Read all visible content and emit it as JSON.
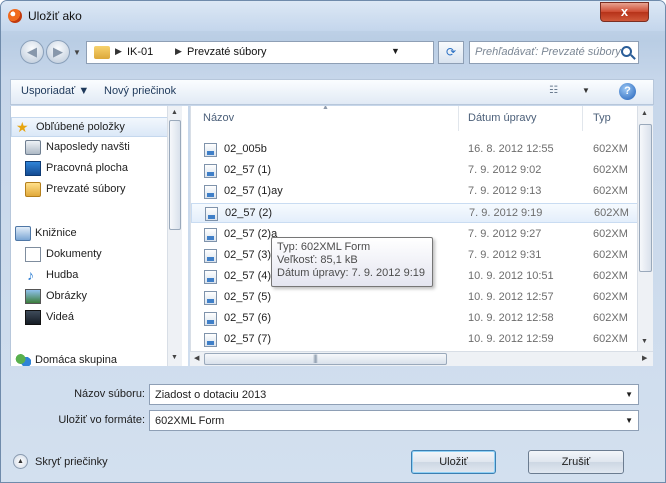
{
  "window": {
    "title": "Uložiť ako",
    "close_label": "x"
  },
  "nav": {
    "back": "◀",
    "forward": "▶"
  },
  "address": {
    "crumbs": [
      "IK-01",
      "Prevzaté súbory"
    ]
  },
  "search": {
    "placeholder": "Prehľadávať: Prevzaté súbory"
  },
  "toolbar": {
    "organize": "Usporiadať ▼",
    "new_folder": "Nový priečinok"
  },
  "sidebar": {
    "favorites_label": "Obľúbené položky",
    "favorites": [
      "Naposledy navšti",
      "Pracovná plocha",
      "Prevzaté súbory"
    ],
    "libraries_label": "Knižnice",
    "libraries": [
      "Dokumenty",
      "Hudba",
      "Obrázky",
      "Videá"
    ],
    "homegroup_label": "Domáca skupina"
  },
  "columns": {
    "name": "Názov",
    "date": "Dátum úpravy",
    "type": "Typ"
  },
  "files": [
    {
      "name": "02_005b",
      "date": "16. 8. 2012 12:55",
      "type": "602XM"
    },
    {
      "name": "02_57 (1)",
      "date": "7. 9. 2012 9:02",
      "type": "602XM"
    },
    {
      "name": "02_57 (1)ay",
      "date": "7. 9. 2012 9:13",
      "type": "602XM"
    },
    {
      "name": "02_57 (2)",
      "date": "7. 9. 2012 9:19",
      "type": "602XM"
    },
    {
      "name": "02_57 (2)a",
      "date": "7. 9. 2012 9:27",
      "type": "602XM"
    },
    {
      "name": "02_57 (3)",
      "date": "7. 9. 2012 9:31",
      "type": "602XM"
    },
    {
      "name": "02_57 (4)",
      "date": "10. 9. 2012 10:51",
      "type": "602XM"
    },
    {
      "name": "02_57 (5)",
      "date": "10. 9. 2012 12:57",
      "type": "602XM"
    },
    {
      "name": "02_57 (6)",
      "date": "10. 9. 2012 12:58",
      "type": "602XM"
    },
    {
      "name": "02_57 (7)",
      "date": "10. 9. 2012 12:59",
      "type": "602XM"
    }
  ],
  "tooltip": {
    "type": "Typ: 602XML Form",
    "size": "Veľkosť: 85,1 kB",
    "modified": "Dátum úpravy: 7. 9. 2012 9:19"
  },
  "form": {
    "filename_label": "Názov súboru:",
    "filename_value": "Ziadost o dotaciu 2013",
    "format_label": "Uložiť vo formáte:",
    "format_value": "602XML Form"
  },
  "footer": {
    "hide_folders": "Skryť priečinky",
    "save": "Uložiť",
    "cancel": "Zrušiť"
  },
  "colors": {
    "title_gradient": "#c4d6ec",
    "close_red": "#cd4a31",
    "selection": "#e3eefb"
  }
}
